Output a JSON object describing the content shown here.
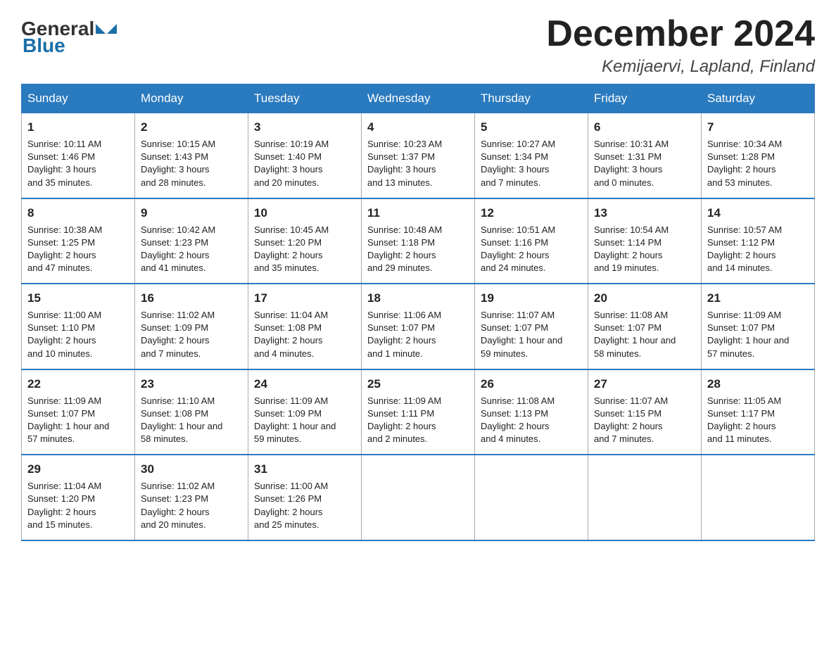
{
  "logo": {
    "general": "General",
    "blue": "Blue"
  },
  "title": "December 2024",
  "location": "Kemijaervi, Lapland, Finland",
  "days_of_week": [
    "Sunday",
    "Monday",
    "Tuesday",
    "Wednesday",
    "Thursday",
    "Friday",
    "Saturday"
  ],
  "weeks": [
    [
      {
        "num": "1",
        "info": "Sunrise: 10:11 AM\nSunset: 1:46 PM\nDaylight: 3 hours\nand 35 minutes."
      },
      {
        "num": "2",
        "info": "Sunrise: 10:15 AM\nSunset: 1:43 PM\nDaylight: 3 hours\nand 28 minutes."
      },
      {
        "num": "3",
        "info": "Sunrise: 10:19 AM\nSunset: 1:40 PM\nDaylight: 3 hours\nand 20 minutes."
      },
      {
        "num": "4",
        "info": "Sunrise: 10:23 AM\nSunset: 1:37 PM\nDaylight: 3 hours\nand 13 minutes."
      },
      {
        "num": "5",
        "info": "Sunrise: 10:27 AM\nSunset: 1:34 PM\nDaylight: 3 hours\nand 7 minutes."
      },
      {
        "num": "6",
        "info": "Sunrise: 10:31 AM\nSunset: 1:31 PM\nDaylight: 3 hours\nand 0 minutes."
      },
      {
        "num": "7",
        "info": "Sunrise: 10:34 AM\nSunset: 1:28 PM\nDaylight: 2 hours\nand 53 minutes."
      }
    ],
    [
      {
        "num": "8",
        "info": "Sunrise: 10:38 AM\nSunset: 1:25 PM\nDaylight: 2 hours\nand 47 minutes."
      },
      {
        "num": "9",
        "info": "Sunrise: 10:42 AM\nSunset: 1:23 PM\nDaylight: 2 hours\nand 41 minutes."
      },
      {
        "num": "10",
        "info": "Sunrise: 10:45 AM\nSunset: 1:20 PM\nDaylight: 2 hours\nand 35 minutes."
      },
      {
        "num": "11",
        "info": "Sunrise: 10:48 AM\nSunset: 1:18 PM\nDaylight: 2 hours\nand 29 minutes."
      },
      {
        "num": "12",
        "info": "Sunrise: 10:51 AM\nSunset: 1:16 PM\nDaylight: 2 hours\nand 24 minutes."
      },
      {
        "num": "13",
        "info": "Sunrise: 10:54 AM\nSunset: 1:14 PM\nDaylight: 2 hours\nand 19 minutes."
      },
      {
        "num": "14",
        "info": "Sunrise: 10:57 AM\nSunset: 1:12 PM\nDaylight: 2 hours\nand 14 minutes."
      }
    ],
    [
      {
        "num": "15",
        "info": "Sunrise: 11:00 AM\nSunset: 1:10 PM\nDaylight: 2 hours\nand 10 minutes."
      },
      {
        "num": "16",
        "info": "Sunrise: 11:02 AM\nSunset: 1:09 PM\nDaylight: 2 hours\nand 7 minutes."
      },
      {
        "num": "17",
        "info": "Sunrise: 11:04 AM\nSunset: 1:08 PM\nDaylight: 2 hours\nand 4 minutes."
      },
      {
        "num": "18",
        "info": "Sunrise: 11:06 AM\nSunset: 1:07 PM\nDaylight: 2 hours\nand 1 minute."
      },
      {
        "num": "19",
        "info": "Sunrise: 11:07 AM\nSunset: 1:07 PM\nDaylight: 1 hour and\n59 minutes."
      },
      {
        "num": "20",
        "info": "Sunrise: 11:08 AM\nSunset: 1:07 PM\nDaylight: 1 hour and\n58 minutes."
      },
      {
        "num": "21",
        "info": "Sunrise: 11:09 AM\nSunset: 1:07 PM\nDaylight: 1 hour and\n57 minutes."
      }
    ],
    [
      {
        "num": "22",
        "info": "Sunrise: 11:09 AM\nSunset: 1:07 PM\nDaylight: 1 hour and\n57 minutes."
      },
      {
        "num": "23",
        "info": "Sunrise: 11:10 AM\nSunset: 1:08 PM\nDaylight: 1 hour and\n58 minutes."
      },
      {
        "num": "24",
        "info": "Sunrise: 11:09 AM\nSunset: 1:09 PM\nDaylight: 1 hour and\n59 minutes."
      },
      {
        "num": "25",
        "info": "Sunrise: 11:09 AM\nSunset: 1:11 PM\nDaylight: 2 hours\nand 2 minutes."
      },
      {
        "num": "26",
        "info": "Sunrise: 11:08 AM\nSunset: 1:13 PM\nDaylight: 2 hours\nand 4 minutes."
      },
      {
        "num": "27",
        "info": "Sunrise: 11:07 AM\nSunset: 1:15 PM\nDaylight: 2 hours\nand 7 minutes."
      },
      {
        "num": "28",
        "info": "Sunrise: 11:05 AM\nSunset: 1:17 PM\nDaylight: 2 hours\nand 11 minutes."
      }
    ],
    [
      {
        "num": "29",
        "info": "Sunrise: 11:04 AM\nSunset: 1:20 PM\nDaylight: 2 hours\nand 15 minutes."
      },
      {
        "num": "30",
        "info": "Sunrise: 11:02 AM\nSunset: 1:23 PM\nDaylight: 2 hours\nand 20 minutes."
      },
      {
        "num": "31",
        "info": "Sunrise: 11:00 AM\nSunset: 1:26 PM\nDaylight: 2 hours\nand 25 minutes."
      },
      {
        "num": "",
        "info": ""
      },
      {
        "num": "",
        "info": ""
      },
      {
        "num": "",
        "info": ""
      },
      {
        "num": "",
        "info": ""
      }
    ]
  ]
}
